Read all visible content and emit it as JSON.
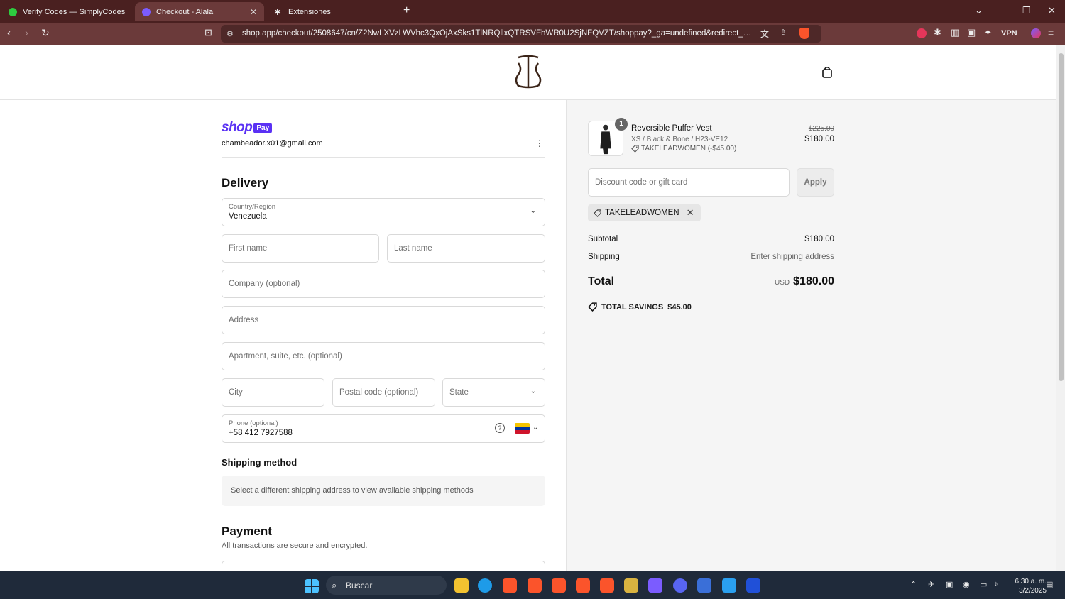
{
  "browser": {
    "tabs": [
      {
        "title": "Verify Codes — SimplyCodes",
        "active": false
      },
      {
        "title": "Checkout - Alala",
        "active": true
      },
      {
        "title": "Extensiones",
        "active": false
      }
    ],
    "url": "shop.app/checkout/2508647/cn/Z2NwLXVzLWVhc3QxOjAxSks1TlNRQllxQTRSVFhWR0U2SjNFQVZT/shoppay?_ga=undefined&redirect_source=che...",
    "brave_badge": "4",
    "vpn_label": "VPN"
  },
  "shoppay": {
    "shop": "shop",
    "pay": "Pay",
    "email": "chambeador.x01@gmail.com"
  },
  "delivery": {
    "heading": "Delivery",
    "country_label": "Country/Region",
    "country_value": "Venezuela",
    "first_name_placeholder": "First name",
    "last_name_placeholder": "Last name",
    "company_placeholder": "Company (optional)",
    "address_placeholder": "Address",
    "apartment_placeholder": "Apartment, suite, etc. (optional)",
    "city_placeholder": "City",
    "postal_placeholder": "Postal code (optional)",
    "state_placeholder": "State",
    "phone_label": "Phone (optional)",
    "phone_value": "+58 412 7927588"
  },
  "shipping_method": {
    "heading": "Shipping method",
    "note": "Select a different shipping address to view available shipping methods"
  },
  "payment": {
    "heading": "Payment",
    "subtitle": "All transactions are secure and encrypted."
  },
  "summary": {
    "item": {
      "qty": "1",
      "name": "Reversible Puffer Vest",
      "variant": "XS / Black & Bone / H23-VE12",
      "discount": "TAKELEADWOMEN (-$45.00)",
      "original_price": "$225.00",
      "price": "$180.00"
    },
    "discount_placeholder": "Discount code or gift card",
    "apply_label": "Apply",
    "applied_code": "TAKELEADWOMEN",
    "subtotal_label": "Subtotal",
    "subtotal_value": "$180.00",
    "shipping_label": "Shipping",
    "shipping_value": "Enter shipping address",
    "total_label": "Total",
    "total_currency": "USD",
    "total_value": "$180.00",
    "savings_label": "TOTAL SAVINGS",
    "savings_value": "$45.00"
  },
  "taskbar": {
    "search_label": "Buscar",
    "time": "6:30 a. m.",
    "date": "3/2/2025"
  },
  "colors": {
    "shop_purple": "#5a31f4",
    "chrome_dark": "#4a2020",
    "chrome_mid": "#6b3a3a"
  }
}
